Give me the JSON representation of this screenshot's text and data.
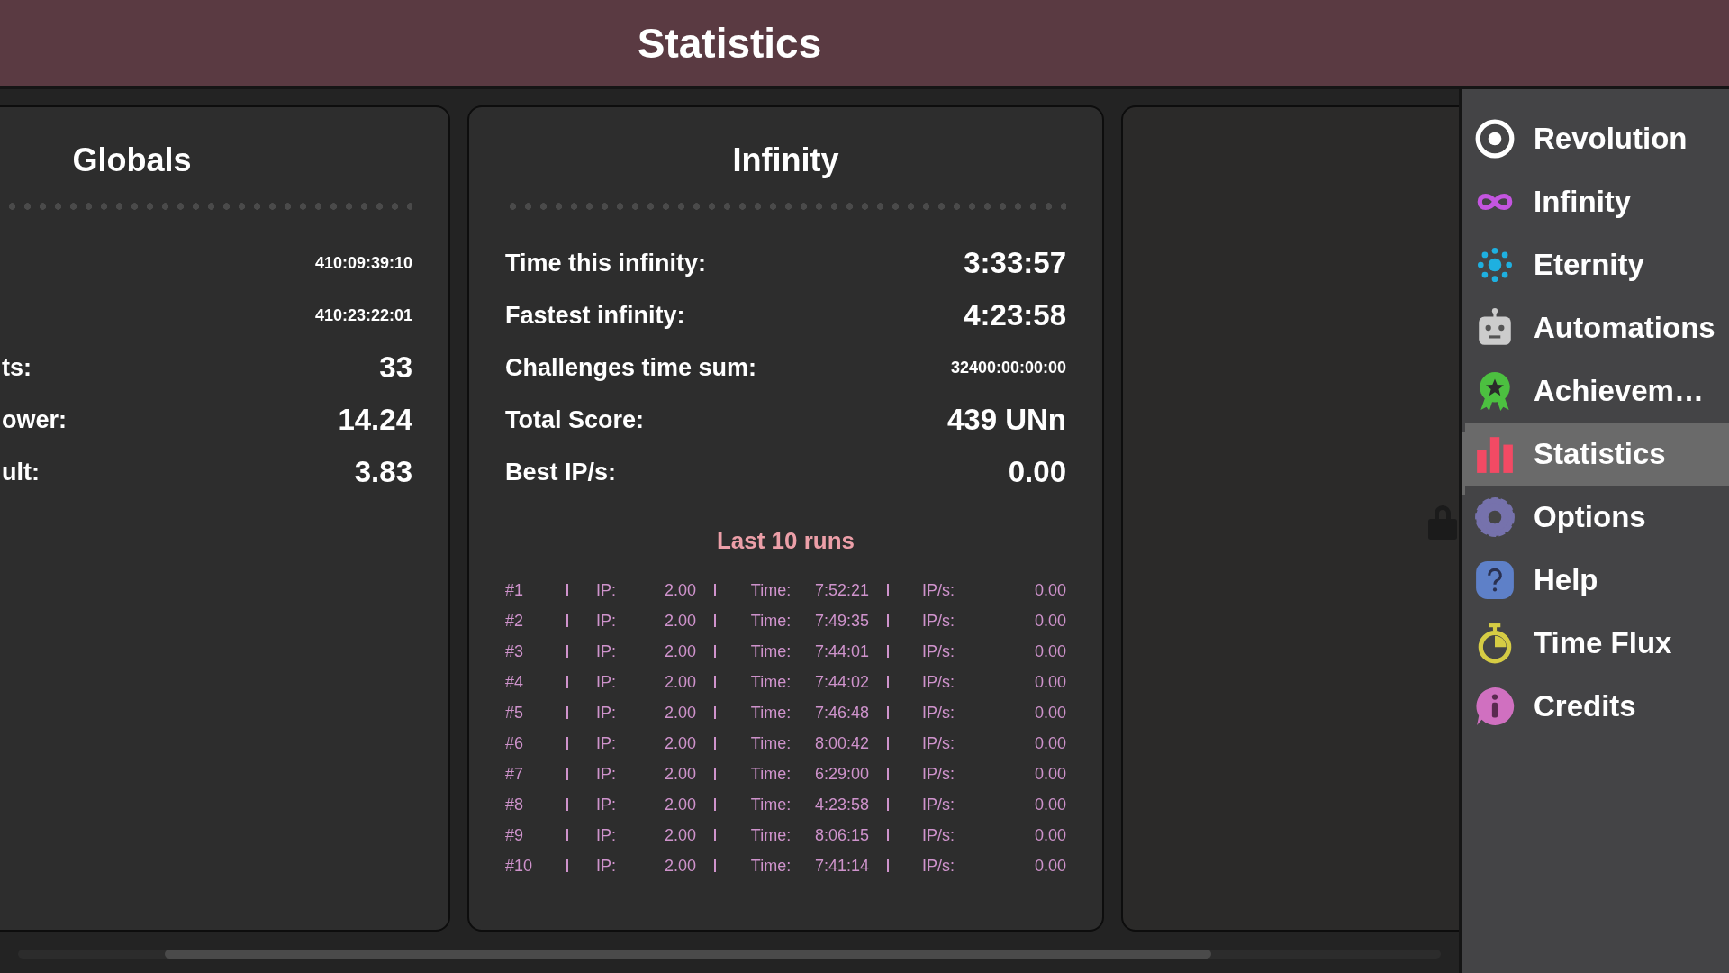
{
  "header": {
    "title": "Statistics"
  },
  "globals": {
    "title": "Globals",
    "rows": [
      {
        "value": "410:09:39:10"
      },
      {
        "value": "410:23:22:01"
      },
      {
        "label": "ts:",
        "value": "33"
      },
      {
        "label": "ower:",
        "value": "14.24"
      },
      {
        "label": "ult:",
        "value": "3.83"
      }
    ]
  },
  "infinity": {
    "title": "Infinity",
    "rows": [
      {
        "label": "Time this infinity:",
        "value": "3:33:57"
      },
      {
        "label": "Fastest infinity:",
        "value": "4:23:58"
      },
      {
        "label": "Challenges time sum:",
        "value": "32400:00:00:00"
      },
      {
        "label": "Total Score:",
        "value": "439 UNn"
      },
      {
        "label": "Best IP/s:",
        "value": "0.00"
      }
    ],
    "runs_title": "Last 10 runs",
    "runs": [
      {
        "rank": "#1",
        "ip_label": "IP:",
        "ip": "2.00",
        "time_label": "Time:",
        "time": "7:52:21",
        "rate_label": "IP/s:",
        "rate": "0.00"
      },
      {
        "rank": "#2",
        "ip_label": "IP:",
        "ip": "2.00",
        "time_label": "Time:",
        "time": "7:49:35",
        "rate_label": "IP/s:",
        "rate": "0.00"
      },
      {
        "rank": "#3",
        "ip_label": "IP:",
        "ip": "2.00",
        "time_label": "Time:",
        "time": "7:44:01",
        "rate_label": "IP/s:",
        "rate": "0.00"
      },
      {
        "rank": "#4",
        "ip_label": "IP:",
        "ip": "2.00",
        "time_label": "Time:",
        "time": "7:44:02",
        "rate_label": "IP/s:",
        "rate": "0.00"
      },
      {
        "rank": "#5",
        "ip_label": "IP:",
        "ip": "2.00",
        "time_label": "Time:",
        "time": "7:46:48",
        "rate_label": "IP/s:",
        "rate": "0.00"
      },
      {
        "rank": "#6",
        "ip_label": "IP:",
        "ip": "2.00",
        "time_label": "Time:",
        "time": "8:00:42",
        "rate_label": "IP/s:",
        "rate": "0.00"
      },
      {
        "rank": "#7",
        "ip_label": "IP:",
        "ip": "2.00",
        "time_label": "Time:",
        "time": "6:29:00",
        "rate_label": "IP/s:",
        "rate": "0.00"
      },
      {
        "rank": "#8",
        "ip_label": "IP:",
        "ip": "2.00",
        "time_label": "Time:",
        "time": "4:23:58",
        "rate_label": "IP/s:",
        "rate": "0.00"
      },
      {
        "rank": "#9",
        "ip_label": "IP:",
        "ip": "2.00",
        "time_label": "Time:",
        "time": "8:06:15",
        "rate_label": "IP/s:",
        "rate": "0.00"
      },
      {
        "rank": "#10",
        "ip_label": "IP:",
        "ip": "2.00",
        "time_label": "Time:",
        "time": "7:41:14",
        "rate_label": "IP/s:",
        "rate": "0.00"
      }
    ]
  },
  "sidebar": {
    "items": [
      {
        "kind": "revolution",
        "label": "Revolution",
        "selected": false
      },
      {
        "kind": "infinity",
        "label": "Infinity",
        "selected": false
      },
      {
        "kind": "eternity",
        "label": "Eternity",
        "selected": false
      },
      {
        "kind": "automations",
        "label": "Automations",
        "selected": false
      },
      {
        "kind": "achievements",
        "label": "Achievem…",
        "selected": false
      },
      {
        "kind": "statistics",
        "label": "Statistics",
        "selected": true
      },
      {
        "kind": "options",
        "label": "Options",
        "selected": false
      },
      {
        "kind": "help",
        "label": "Help",
        "selected": false
      },
      {
        "kind": "timeflux",
        "label": "Time Flux",
        "selected": false
      },
      {
        "kind": "credits",
        "label": "Credits",
        "selected": false
      }
    ]
  }
}
